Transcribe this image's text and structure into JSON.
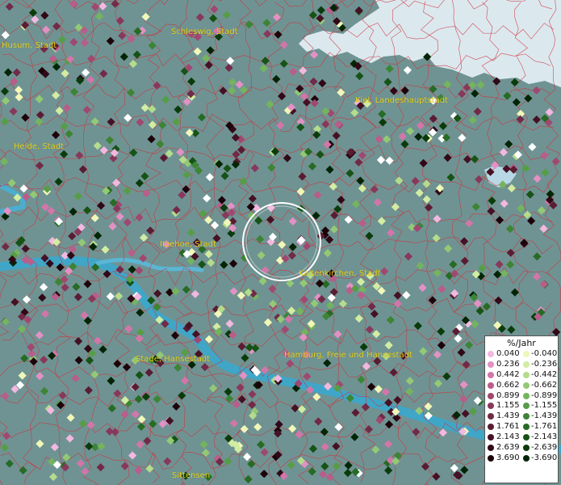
{
  "map": {
    "colors": {
      "land": "#6f9393",
      "sea": "#dbe9ef",
      "river": "#3fa6c8",
      "borders": "#d0303a",
      "label": "#e8d21a"
    },
    "places": [
      {
        "name": "Husum, Stadt"
      },
      {
        "name": "Schleswig, Stadt"
      },
      {
        "name": "Kiel, Landeshauptstadt"
      },
      {
        "name": "Heide, Stadt"
      },
      {
        "name": "Itzehoe, Stadt"
      },
      {
        "name": "Kaltenkirchen, Stadt"
      },
      {
        "name": "Stade, Hansestadt"
      },
      {
        "name": "Hamburg, Freie und Hansestadt"
      },
      {
        "name": "Sittensen"
      }
    ]
  },
  "legend": {
    "title": "%/Jahr",
    "positive": [
      {
        "label": "0.040",
        "color": "#f2b8e0"
      },
      {
        "label": "0.236",
        "color": "#e391c4"
      },
      {
        "label": "0.442",
        "color": "#d276a9"
      },
      {
        "label": "0.662",
        "color": "#b95d8a"
      },
      {
        "label": "0.899",
        "color": "#a04870"
      },
      {
        "label": "1.155",
        "color": "#88385b"
      },
      {
        "label": "1.439",
        "color": "#712a47"
      },
      {
        "label": "1.761",
        "color": "#5a1c33"
      },
      {
        "label": "2.143",
        "color": "#451124"
      },
      {
        "label": "2.639",
        "color": "#300816"
      },
      {
        "label": "3.690",
        "color": "#1c0209"
      }
    ],
    "negative": [
      {
        "label": "-0.040",
        "color": "#f0f7b8"
      },
      {
        "label": "-0.236",
        "color": "#d2eda2"
      },
      {
        "label": "-0.442",
        "color": "#b4dc8c"
      },
      {
        "label": "-0.662",
        "color": "#93c975"
      },
      {
        "label": "-0.899",
        "color": "#74b45e"
      },
      {
        "label": "-1.155",
        "color": "#579d48"
      },
      {
        "label": "-1.439",
        "color": "#3d8435"
      },
      {
        "label": "-1.761",
        "color": "#276b24"
      },
      {
        "label": "-2.143",
        "color": "#165316"
      },
      {
        "label": "-2.639",
        "color": "#0a3c0b"
      },
      {
        "label": "-3.690",
        "color": "#022505"
      }
    ]
  }
}
